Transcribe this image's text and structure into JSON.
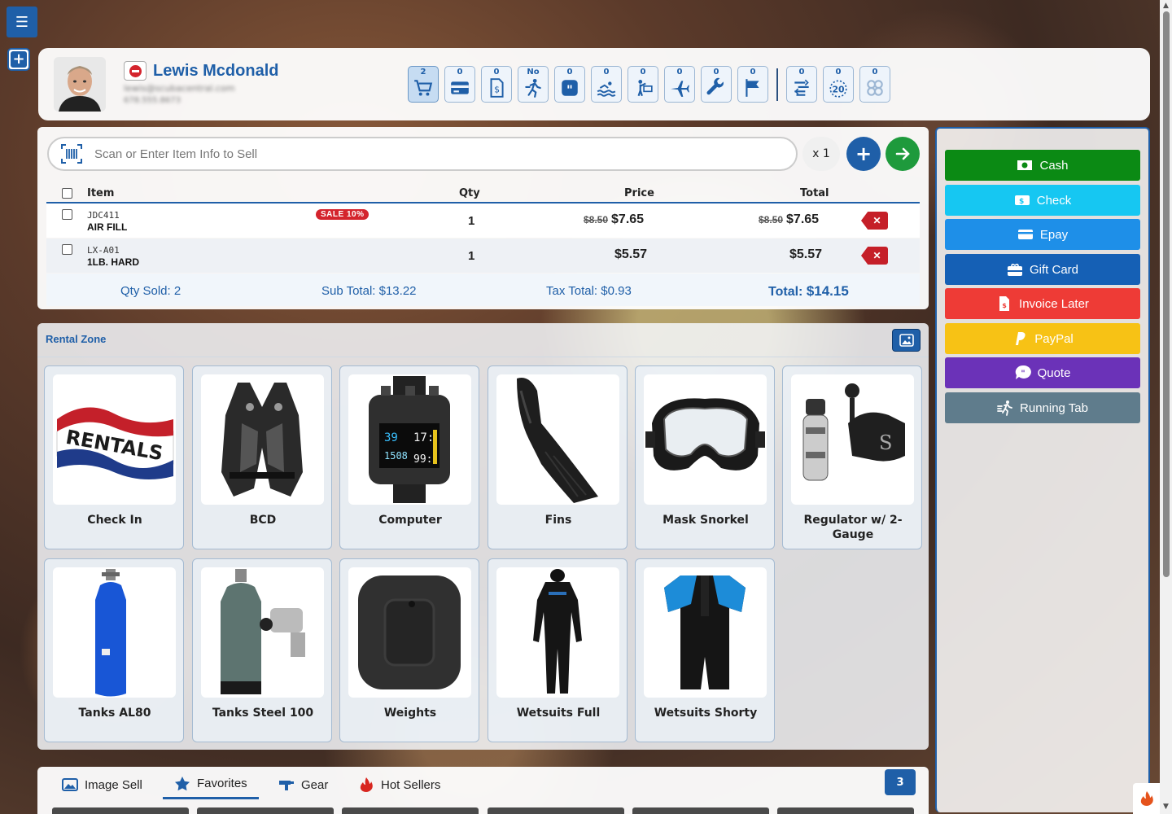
{
  "nav": {
    "menu_icon": "☰",
    "add_icon": "+"
  },
  "customer": {
    "name": "Lewis Mcdonald",
    "email_blurred": "lewis@scubacentral.com",
    "phone_blurred": "678.555.8673"
  },
  "stats": [
    {
      "id": "cart",
      "count": "2",
      "icon": "cart-icon"
    },
    {
      "id": "card",
      "count": "0",
      "icon": "credit-card-icon"
    },
    {
      "id": "invoice",
      "count": "0",
      "icon": "invoice-dollar-icon"
    },
    {
      "id": "running",
      "count": "No",
      "icon": "running-person-icon"
    },
    {
      "id": "quote",
      "count": "0",
      "icon": "quote-icon"
    },
    {
      "id": "swim",
      "count": "0",
      "icon": "swimmer-icon"
    },
    {
      "id": "instructor",
      "count": "0",
      "icon": "instructor-icon"
    },
    {
      "id": "trip",
      "count": "0",
      "icon": "plane-icon"
    },
    {
      "id": "service",
      "count": "0",
      "icon": "wrench-icon"
    },
    {
      "id": "flag",
      "count": "0",
      "icon": "flag-icon"
    },
    {
      "id": "rental",
      "count": "0",
      "icon": "rental-return-icon"
    },
    {
      "id": "twenty",
      "count": "0",
      "icon": "twenty-badge-icon"
    },
    {
      "id": "gear",
      "count": "0",
      "icon": "gear-cluster-icon"
    }
  ],
  "search": {
    "placeholder": "Scan or Enter Item Info to Sell",
    "multiplier": "x 1"
  },
  "cart": {
    "headers": {
      "item": "Item",
      "qty": "Qty",
      "price": "Price",
      "total": "Total"
    },
    "rows": [
      {
        "sku": "JDC411",
        "name": "AIR FILL",
        "badge": "SALE 10%",
        "qty": "1",
        "orig_price": "$8.50",
        "price": "$7.65",
        "orig_total": "$8.50",
        "total": "$7.65"
      },
      {
        "sku": "LX-A01",
        "name": "1LB. HARD",
        "badge": "",
        "qty": "1",
        "orig_price": "",
        "price": "$5.57",
        "orig_total": "",
        "total": "$5.57"
      }
    ],
    "totals": {
      "qty_sold_label": "Qty Sold:",
      "qty_sold": "2",
      "subtotal_label": "Sub Total:",
      "subtotal": "$13.22",
      "tax_label": "Tax Total:",
      "tax": "$0.93",
      "total_label": "Total:",
      "total": "$14.15"
    }
  },
  "rental_zone": {
    "title": "Rental Zone",
    "items": [
      {
        "label": "Check In",
        "image": "rentals-flag"
      },
      {
        "label": "BCD",
        "image": "bcd-vest"
      },
      {
        "label": "Computer",
        "image": "dive-computer"
      },
      {
        "label": "Fins",
        "image": "fins"
      },
      {
        "label": "Mask Snorkel",
        "image": "mask"
      },
      {
        "label": "Regulator w/ 2-Gauge",
        "image": "regulator"
      },
      {
        "label": "Tanks AL80",
        "image": "tank-blue"
      },
      {
        "label": "Tanks Steel 100",
        "image": "tank-steel"
      },
      {
        "label": "Weights",
        "image": "weight-block"
      },
      {
        "label": "Wetsuits Full",
        "image": "wetsuit-full"
      },
      {
        "label": "Wetsuits Shorty",
        "image": "wetsuit-shorty"
      }
    ]
  },
  "payments": [
    {
      "label": "Cash",
      "color": "#0b8a14",
      "icon": "cash-icon"
    },
    {
      "label": "Check",
      "color": "#16c7f2",
      "icon": "check-icon"
    },
    {
      "label": "Epay",
      "color": "#1e8fe8",
      "icon": "card-icon"
    },
    {
      "label": "Gift Card",
      "color": "#1560b5",
      "icon": "gift-card-icon"
    },
    {
      "label": "Invoice Later",
      "color": "#ee3b36",
      "icon": "invoice-icon"
    },
    {
      "label": "PayPal",
      "color": "#f7c215",
      "icon": "paypal-icon"
    },
    {
      "label": "Quote",
      "color": "#6b32b8",
      "icon": "quote-bubble-icon"
    },
    {
      "label": "Running Tab",
      "color": "#5f7c8c",
      "icon": "running-tab-icon"
    }
  ],
  "tabs": [
    {
      "label": "Image Sell",
      "icon": "image-icon"
    },
    {
      "label": "Favorites",
      "icon": "star-icon"
    },
    {
      "label": "Gear",
      "icon": "gear-gun-icon"
    },
    {
      "label": "Hot Sellers",
      "icon": "fire-icon"
    }
  ],
  "tabs_count": "3"
}
